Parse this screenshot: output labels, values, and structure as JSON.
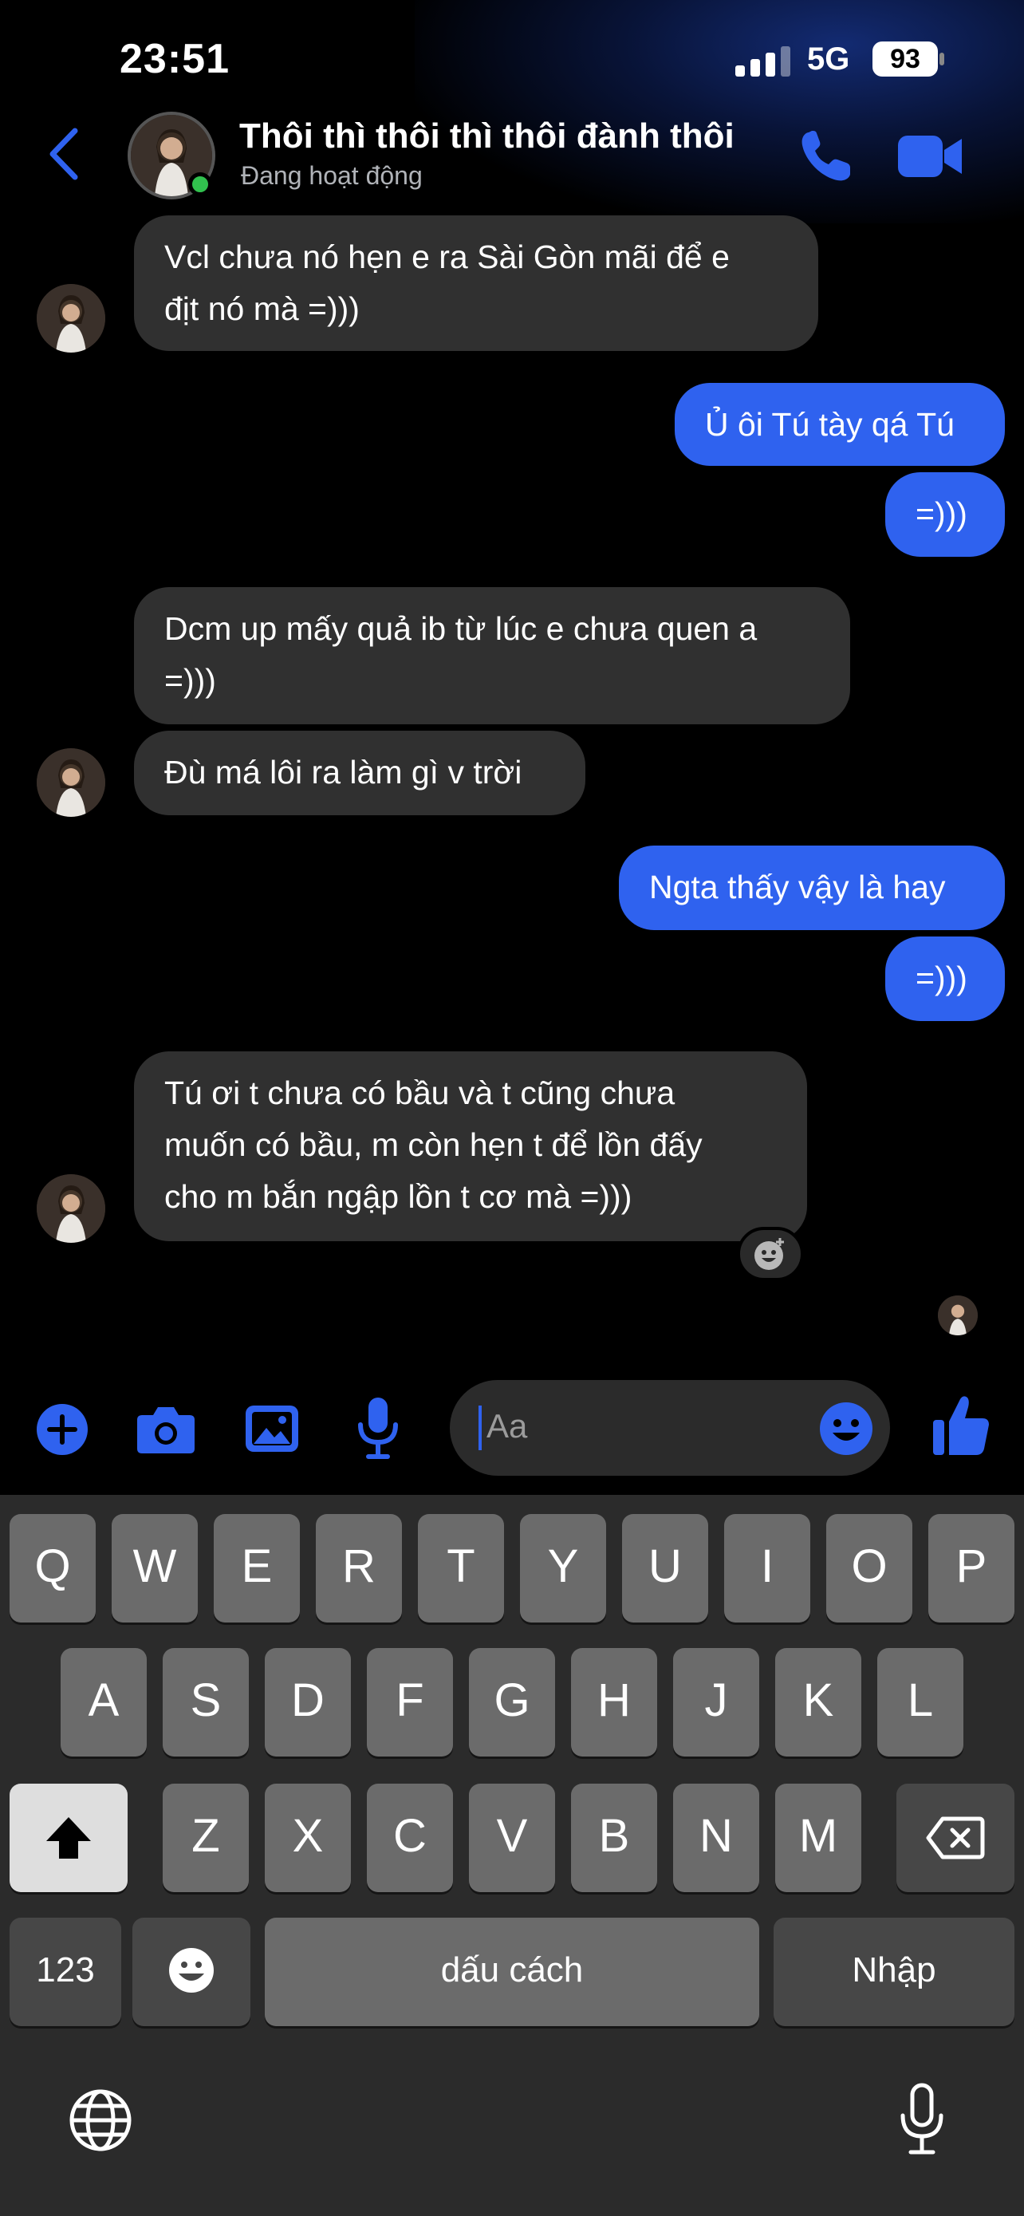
{
  "status_bar": {
    "time": "23:51",
    "network": "5G",
    "battery": "93"
  },
  "header": {
    "title": "Thôi thì thôi thì thôi đành thôi",
    "subtitle": "Đang hoạt động"
  },
  "messages": [
    {
      "side": "in",
      "lines": [
        "Vcl chưa nó hẹn e ra Sài Gòn mãi để e",
        "địt nó mà =)))"
      ]
    },
    {
      "side": "out",
      "lines": [
        "Ủ ôi Tú tày qá Tú"
      ]
    },
    {
      "side": "out",
      "lines": [
        "=)))"
      ]
    },
    {
      "side": "in",
      "lines": [
        "Dcm up mấy quả ib từ lúc e chưa quen a",
        "=)))"
      ]
    },
    {
      "side": "in",
      "lines": [
        "Đù má lôi ra làm gì v trời"
      ]
    },
    {
      "side": "out",
      "lines": [
        "Ngta thấy vậy là hay"
      ]
    },
    {
      "side": "out",
      "lines": [
        "=)))"
      ]
    },
    {
      "side": "in",
      "lines": [
        "Tú ơi t chưa có bầu và t cũng chưa",
        "muốn có bầu, m còn hẹn t để lồn đấy",
        "cho m bắn ngập lồn t cơ mà =)))"
      ]
    }
  ],
  "composer": {
    "placeholder": "Aa"
  },
  "keyboard": {
    "row1": [
      "Q",
      "W",
      "E",
      "R",
      "T",
      "Y",
      "U",
      "I",
      "O",
      "P"
    ],
    "row2": [
      "A",
      "S",
      "D",
      "F",
      "G",
      "H",
      "J",
      "K",
      "L"
    ],
    "row3": [
      "Z",
      "X",
      "C",
      "V",
      "B",
      "N",
      "M"
    ],
    "numbers_key": "123",
    "space_key": "dấu cách",
    "return_key": "Nhập"
  },
  "colors": {
    "accent": "#2f62ef",
    "incoming_bubble": "#303030",
    "online": "#31c14e"
  }
}
